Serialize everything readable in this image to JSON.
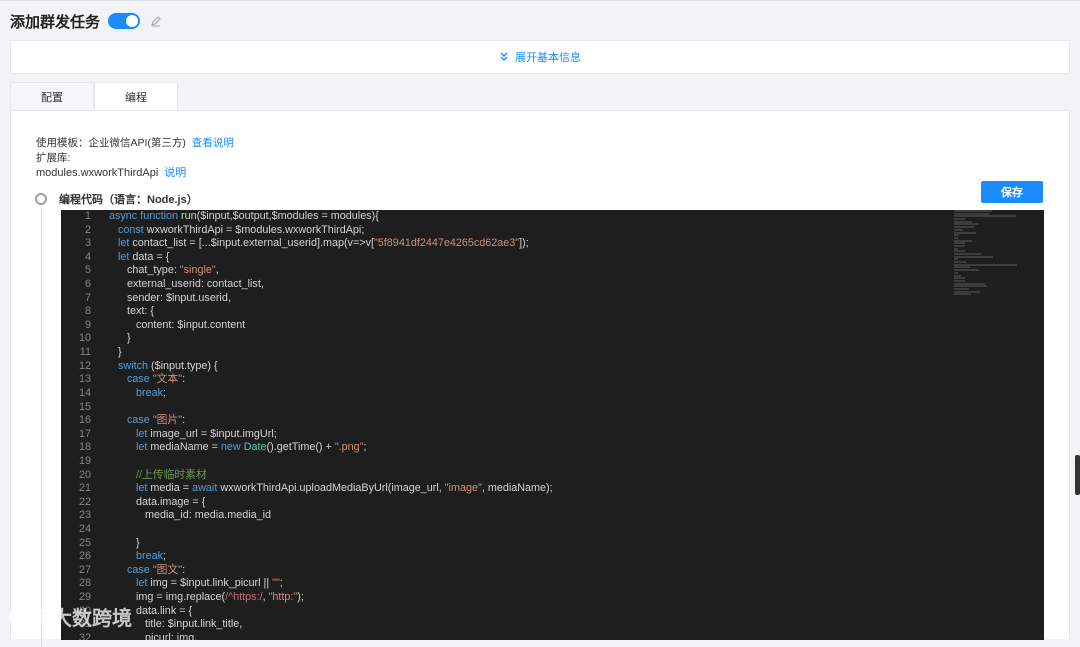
{
  "header": {
    "title": "添加群发任务",
    "toggle_on": true
  },
  "expand": {
    "label": "展开基本信息"
  },
  "tabs": [
    {
      "label": "配置",
      "active": false
    },
    {
      "label": "编程",
      "active": true
    }
  ],
  "info": {
    "template_label": "使用模板：企业微信API(第三方)",
    "view_doc": "查看说明",
    "ext_label": "扩展库:",
    "module_name": "modules.wxworkThirdApi",
    "module_doc": "说明"
  },
  "code_label": "编程代码（语言：Node.js）",
  "save_label": "保存",
  "watermark": "大数跨境",
  "colors": {
    "accent": "#1a8cff",
    "editor_bg": "#1e1e1e"
  },
  "code": [
    [
      [
        "kw",
        "async function "
      ],
      [
        "fn",
        "run"
      ],
      [
        "src",
        "($input,$output,$modules = modules){"
      ]
    ],
    [
      [
        "src",
        "   "
      ],
      [
        "kw",
        "const"
      ],
      [
        "src",
        " wxworkThirdApi = $modules.wxworkThirdApi;"
      ]
    ],
    [
      [
        "src",
        "   "
      ],
      [
        "kw",
        "let"
      ],
      [
        "src",
        " contact_list = [...$input.external_userid].map(v=>v["
      ],
      [
        "str",
        "\"5f8941df2447e4265cd62ae3\""
      ],
      [
        "src",
        "]);"
      ]
    ],
    [
      [
        "src",
        "   "
      ],
      [
        "kw",
        "let"
      ],
      [
        "src",
        " data = {"
      ]
    ],
    [
      [
        "src",
        "      chat_type: "
      ],
      [
        "str",
        "\"single\""
      ],
      [
        "src",
        ","
      ]
    ],
    [
      [
        "src",
        "      external_userid: contact_list,"
      ]
    ],
    [
      [
        "src",
        "      sender: $input.userid,"
      ]
    ],
    [
      [
        "src",
        "      text: {"
      ]
    ],
    [
      [
        "src",
        "         content: $input.content"
      ]
    ],
    [
      [
        "src",
        "      }"
      ]
    ],
    [
      [
        "src",
        "   }"
      ]
    ],
    [
      [
        "src",
        "   "
      ],
      [
        "kw",
        "switch"
      ],
      [
        "src",
        " ($input.type) {"
      ]
    ],
    [
      [
        "src",
        "      "
      ],
      [
        "kw",
        "case"
      ],
      [
        "src",
        " "
      ],
      [
        "str",
        "\"文本\""
      ],
      [
        "src",
        ":"
      ]
    ],
    [
      [
        "src",
        "         "
      ],
      [
        "kw",
        "break"
      ],
      [
        "src",
        ";"
      ]
    ],
    [
      [
        "src",
        ""
      ]
    ],
    [
      [
        "src",
        "      "
      ],
      [
        "kw",
        "case"
      ],
      [
        "src",
        " "
      ],
      [
        "str",
        "\"图片\""
      ],
      [
        "src",
        ":"
      ]
    ],
    [
      [
        "src",
        "         "
      ],
      [
        "kw",
        "let"
      ],
      [
        "src",
        " image_url = $input.imgUrl;"
      ]
    ],
    [
      [
        "src",
        "         "
      ],
      [
        "kw",
        "let"
      ],
      [
        "src",
        " mediaName = "
      ],
      [
        "kw",
        "new"
      ],
      [
        "src",
        " "
      ],
      [
        "ty",
        "Date"
      ],
      [
        "src",
        "().getTime() + "
      ],
      [
        "str",
        "\".png\""
      ],
      [
        "src",
        ";"
      ]
    ],
    [
      [
        "src",
        ""
      ]
    ],
    [
      [
        "src",
        "         "
      ],
      [
        "cm",
        "//上传临时素材"
      ]
    ],
    [
      [
        "src",
        "         "
      ],
      [
        "kw",
        "let"
      ],
      [
        "src",
        " media = "
      ],
      [
        "kw",
        "await"
      ],
      [
        "src",
        " wxworkThirdApi.uploadMediaByUrl(image_url, "
      ],
      [
        "str",
        "\"image\""
      ],
      [
        "src",
        ", mediaName);"
      ]
    ],
    [
      [
        "src",
        "         data.image = {"
      ]
    ],
    [
      [
        "src",
        "            media_id: media.media_id"
      ]
    ],
    [
      [
        "src",
        ""
      ]
    ],
    [
      [
        "src",
        "         }"
      ]
    ],
    [
      [
        "src",
        "         "
      ],
      [
        "kw",
        "break"
      ],
      [
        "src",
        ";"
      ]
    ],
    [
      [
        "src",
        "      "
      ],
      [
        "kw",
        "case"
      ],
      [
        "src",
        " "
      ],
      [
        "str",
        "\"图文\""
      ],
      [
        "src",
        ":"
      ]
    ],
    [
      [
        "src",
        "         "
      ],
      [
        "kw",
        "let"
      ],
      [
        "src",
        " img = $input.link_picurl || "
      ],
      [
        "str",
        "\"\""
      ],
      [
        "src",
        ";"
      ]
    ],
    [
      [
        "src",
        "         img = img.replace("
      ],
      [
        "re",
        "/^https:/"
      ],
      [
        "src",
        ", "
      ],
      [
        "str",
        "\"http:\""
      ],
      [
        "src",
        ");"
      ]
    ],
    [
      [
        "src",
        "         data.link = {"
      ]
    ],
    [
      [
        "src",
        "            title: $input.link_title,"
      ]
    ],
    [
      [
        "src",
        "            picurl: img,"
      ]
    ]
  ]
}
